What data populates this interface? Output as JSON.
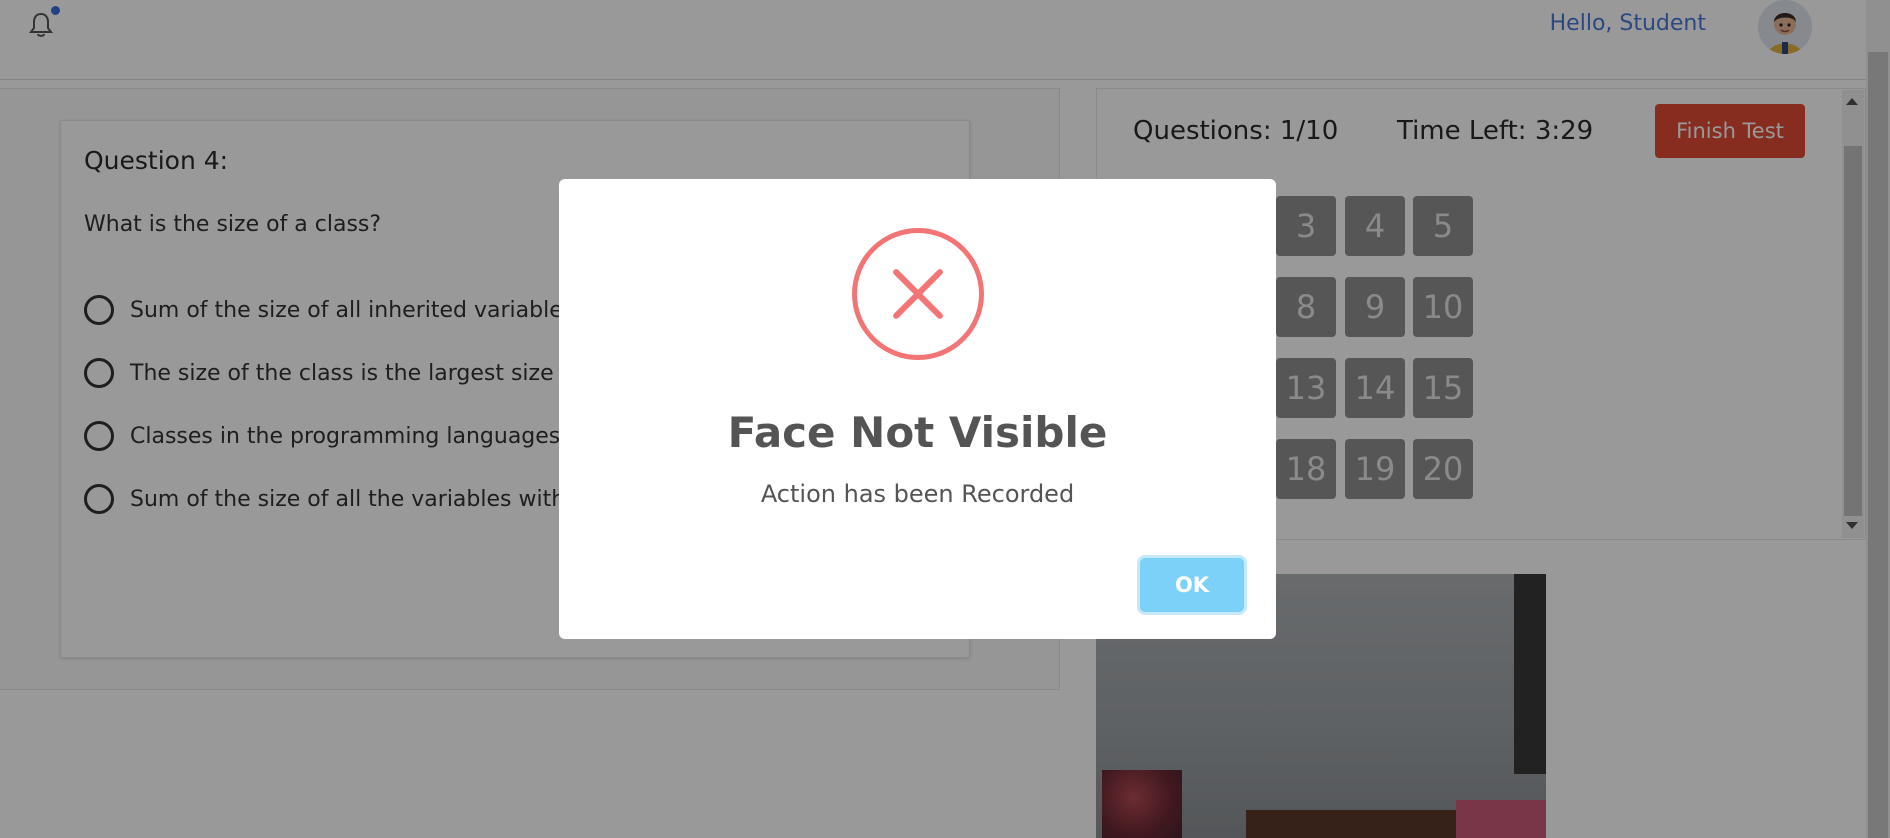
{
  "header": {
    "greeting": "Hello, Student"
  },
  "question": {
    "title": "Question 4:",
    "text": "What is the size of a class?",
    "options": [
      "Sum of the size of all inherited variables alon",
      "The size of the class is the largest size of the",
      "Classes in the programming languages do n",
      "Sum of the size of all the variables within a cla"
    ]
  },
  "status": {
    "questions": "Questions: 1/10",
    "time_left": "Time Left: 3:29",
    "finish_label": "Finish Test"
  },
  "navigator": {
    "visible_numbers": [
      "3",
      "4",
      "5",
      "8",
      "9",
      "10",
      "13",
      "14",
      "15",
      "18",
      "19",
      "20"
    ]
  },
  "modal": {
    "title": "Face Not Visible",
    "message": "Action has been Recorded",
    "ok_label": "OK"
  },
  "colors": {
    "accent_blue": "#4a78d8",
    "finish_red": "#e24c36",
    "error_red": "#f27474",
    "ok_blue": "#7cd1f9"
  },
  "icons": {
    "notification": "bell-icon",
    "error": "error-x-icon"
  }
}
